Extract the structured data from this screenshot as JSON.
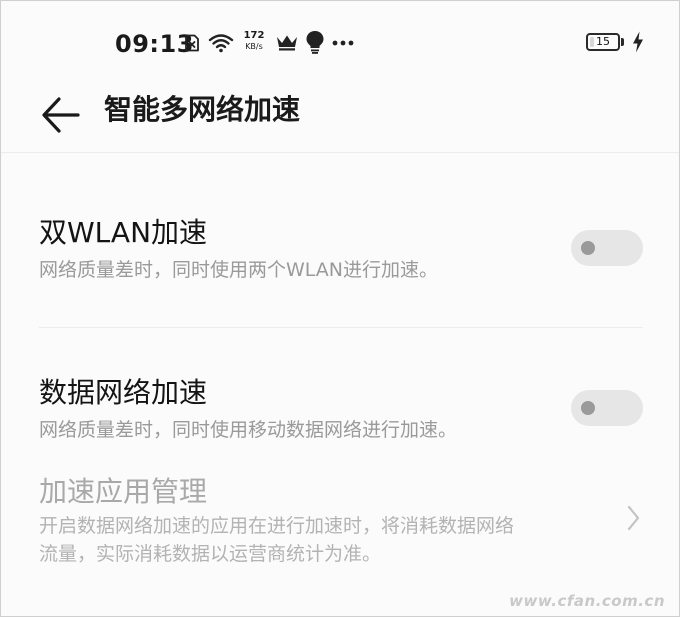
{
  "status_bar": {
    "time": "09:13",
    "net_speed_value": "172",
    "net_speed_unit": "KB/s",
    "battery_level": "15",
    "battery_fraction": 0.15,
    "icons": [
      "close-box-icon",
      "wifi-icon",
      "crown-icon",
      "lightbulb-icon",
      "more-dots-icon",
      "battery-icon",
      "charging-bolt-icon"
    ]
  },
  "header": {
    "back_icon": "arrow-left-icon",
    "title": "智能多网络加速"
  },
  "settings": [
    {
      "title": "双WLAN加速",
      "description": "网络质量差时，同时使用两个WLAN进行加速。",
      "control": "toggle",
      "enabled": false
    },
    {
      "title": "数据网络加速",
      "description": "网络质量差时，同时使用移动数据网络进行加速。",
      "control": "toggle",
      "enabled": false
    },
    {
      "title": "加速应用管理",
      "description_line1": "开启数据网络加速的应用在进行加速时，将消耗数据网络",
      "description_line2": "流量，实际消耗数据以运营商统计为准。",
      "control": "chevron",
      "disabled": true
    }
  ],
  "colors": {
    "background": "#fbfbfb",
    "title_text": "#141414",
    "secondary_text": "#9a9a9a",
    "toggle_track_off": "#e6e6e6",
    "toggle_knob_off": "#9a9a9a"
  },
  "watermark": "www.cfan.com.cn"
}
